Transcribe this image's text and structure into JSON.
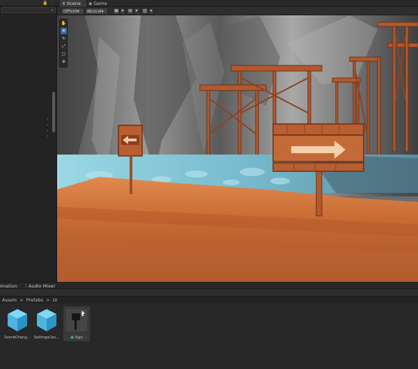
{
  "tabs": {
    "scene": "Scene",
    "game": "Game"
  },
  "toolbar": {
    "pivot": "Pivot",
    "local": "Local",
    "pivot_icon": "pivot-icon",
    "local_icon": "local-icon"
  },
  "tools": [
    {
      "name": "hand-tool-icon",
      "glyph": "✋",
      "selected": false
    },
    {
      "name": "move-tool-icon",
      "glyph": "✥",
      "selected": true
    },
    {
      "name": "rotate-tool-icon",
      "glyph": "↻",
      "selected": false
    },
    {
      "name": "scale-tool-icon",
      "glyph": "⤢",
      "selected": false
    },
    {
      "name": "rect-tool-icon",
      "glyph": "▢",
      "selected": false
    },
    {
      "name": "transform-tool-icon",
      "glyph": "⊕",
      "selected": false
    }
  ],
  "bottom": {
    "animation_tab": "imation",
    "audio_mixer_tab": "Audio Mixer",
    "breadcrumb": [
      "Assets",
      ">",
      "Prefabs",
      ">",
      "UI"
    ]
  },
  "assets": [
    {
      "label": "SceneChang…",
      "icon": "prefab-cube-icon",
      "selected": false
    },
    {
      "label": "SettingsCan…",
      "icon": "prefab-cube-icon",
      "selected": false
    },
    {
      "label": "Sign",
      "icon": "sign-prefab-icon",
      "selected": true
    }
  ],
  "colors": {
    "accent": "#3b6ea5",
    "prefab_blue": "#5bc7f2",
    "sand": "#d1763d",
    "water": "#8fd4e2"
  }
}
